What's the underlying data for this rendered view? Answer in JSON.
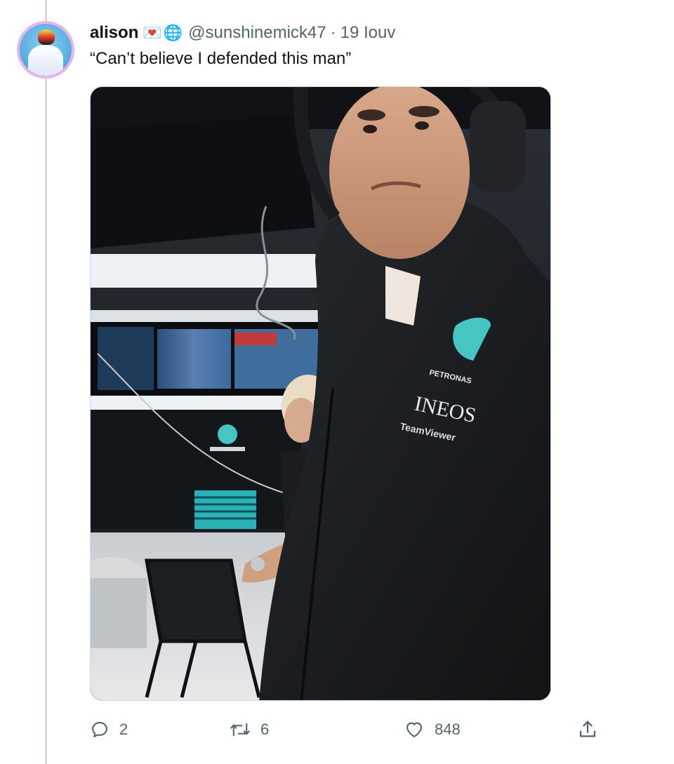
{
  "tweet": {
    "author": {
      "display_name": "alison",
      "emoji_1": "💌",
      "emoji_2": "🌐",
      "handle": "@sunshinemick47",
      "separator": "·",
      "date": "19 Iouv"
    },
    "text": "“Can’t believe I defended this man”",
    "media": {
      "type": "photo",
      "sponsor_texts": [
        "PETRONAS",
        "INEOS",
        "TeamViewer"
      ]
    },
    "actions": {
      "reply_count": "2",
      "retweet_count": "6",
      "like_count": "848"
    }
  },
  "icons": {
    "reply": "reply-icon",
    "retweet": "retweet-icon",
    "like": "heart-icon",
    "share": "share-icon"
  },
  "colors": {
    "secondary_text": "#536471",
    "primary_text": "#0f1419",
    "thread_line": "#cfd9de",
    "petronas_teal": "#46c6c3"
  }
}
